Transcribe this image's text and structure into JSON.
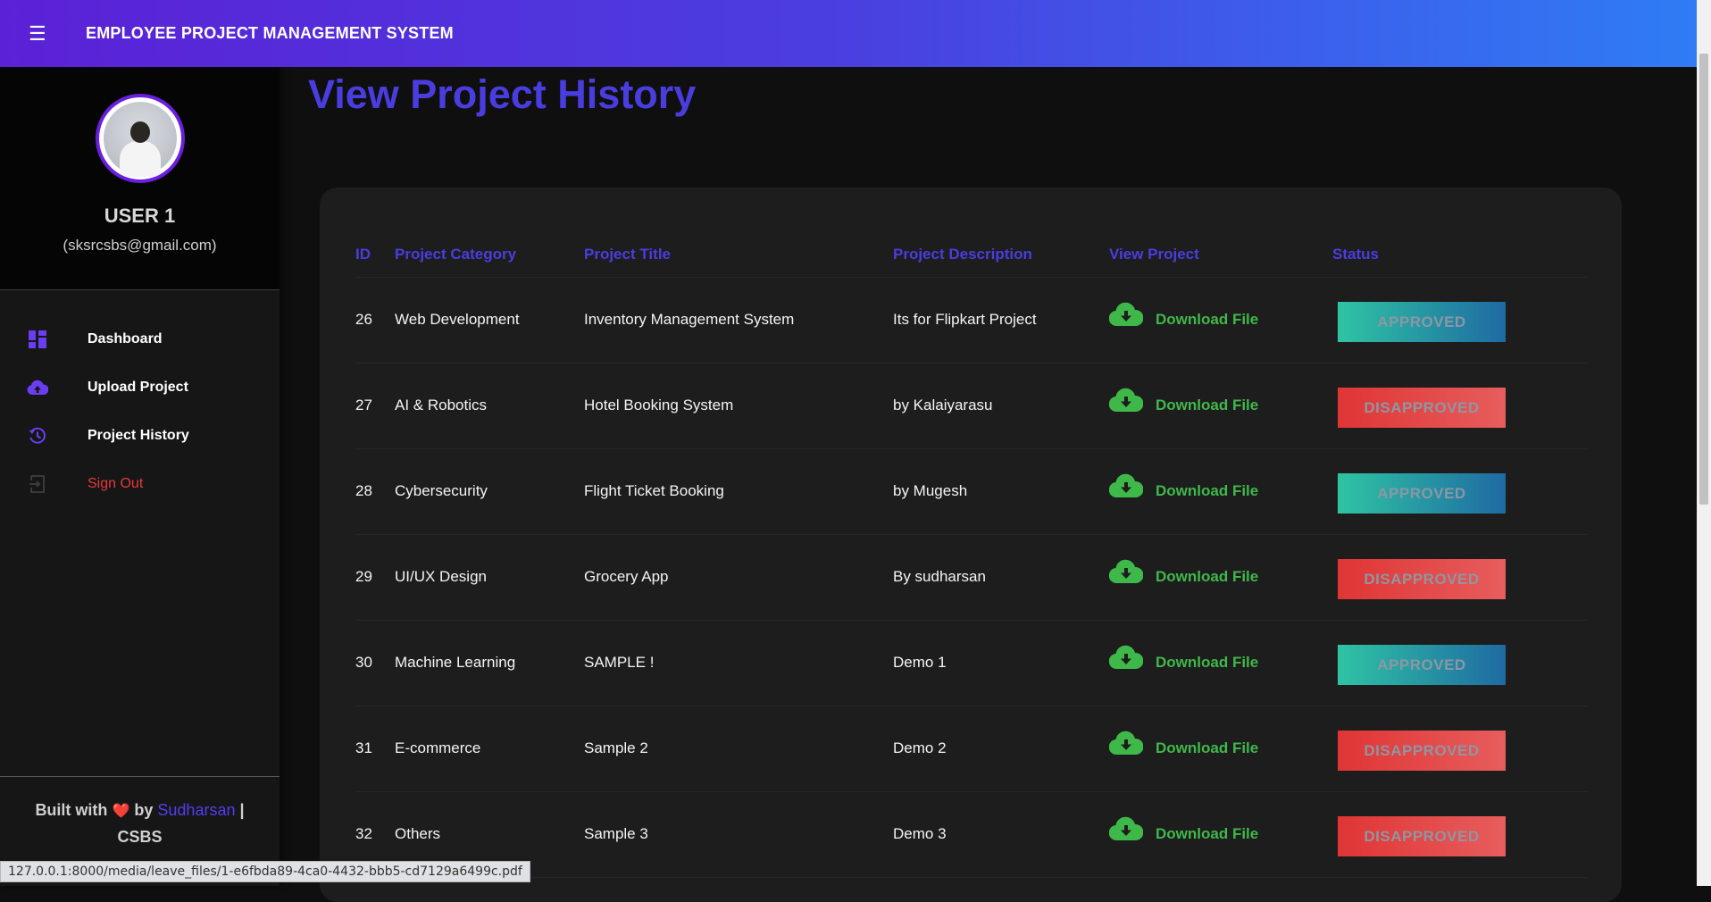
{
  "app": {
    "title": "EMPLOYEE PROJECT MANAGEMENT SYSTEM",
    "menu_icon": "hamburger-icon"
  },
  "profile": {
    "name": "USER 1",
    "email": "(sksrcsbs@gmail.com)"
  },
  "nav": {
    "items": [
      {
        "label": "Dashboard",
        "icon": "dashboard-icon"
      },
      {
        "label": "Upload Project",
        "icon": "cloud-upload-icon"
      },
      {
        "label": "Project History",
        "icon": "history-icon"
      },
      {
        "label": "Sign Out",
        "icon": "sign-out-icon"
      }
    ]
  },
  "footer": {
    "built_with": "Built with",
    "by": "by",
    "author": "Sudharsan",
    "separator": "|",
    "org": "CSBS"
  },
  "page": {
    "title": "View Project History"
  },
  "table": {
    "headers": {
      "id": "ID",
      "category": "Project Category",
      "title": "Project Title",
      "description": "Project Description",
      "view": "View Project",
      "status": "Status"
    },
    "download_label": "Download File",
    "rows": [
      {
        "id": "26",
        "category": "Web Development",
        "title": "Inventory Management System",
        "description": "Its for Flipkart Project",
        "status": "APPROVED"
      },
      {
        "id": "27",
        "category": "AI & Robotics",
        "title": "Hotel Booking System",
        "description": "by Kalaiyarasu",
        "status": "DISAPPROVED"
      },
      {
        "id": "28",
        "category": "Cybersecurity",
        "title": "Flight Ticket Booking",
        "description": "by Mugesh",
        "status": "APPROVED"
      },
      {
        "id": "29",
        "category": "UI/UX Design",
        "title": "Grocery App",
        "description": "By sudharsan",
        "status": "DISAPPROVED"
      },
      {
        "id": "30",
        "category": "Machine Learning",
        "title": "SAMPLE !",
        "description": "Demo 1",
        "status": "APPROVED"
      },
      {
        "id": "31",
        "category": "E-commerce",
        "title": "Sample 2",
        "description": "Demo 2",
        "status": "DISAPPROVED"
      },
      {
        "id": "32",
        "category": "Others",
        "title": "Sample 3",
        "description": "Demo 3",
        "status": "DISAPPROVED"
      }
    ]
  },
  "status_bar": {
    "url": "127.0.0.1:8000/media/leave_files/1-e6fbda89-4ca0-4432-bbb5-cd7129a6499c.pdf"
  },
  "colors": {
    "accent": "#4a3de0",
    "approved": "#2ec4a3",
    "disapproved": "#e03535",
    "download": "#3fb84a",
    "sign_out": "#e63a3a"
  }
}
